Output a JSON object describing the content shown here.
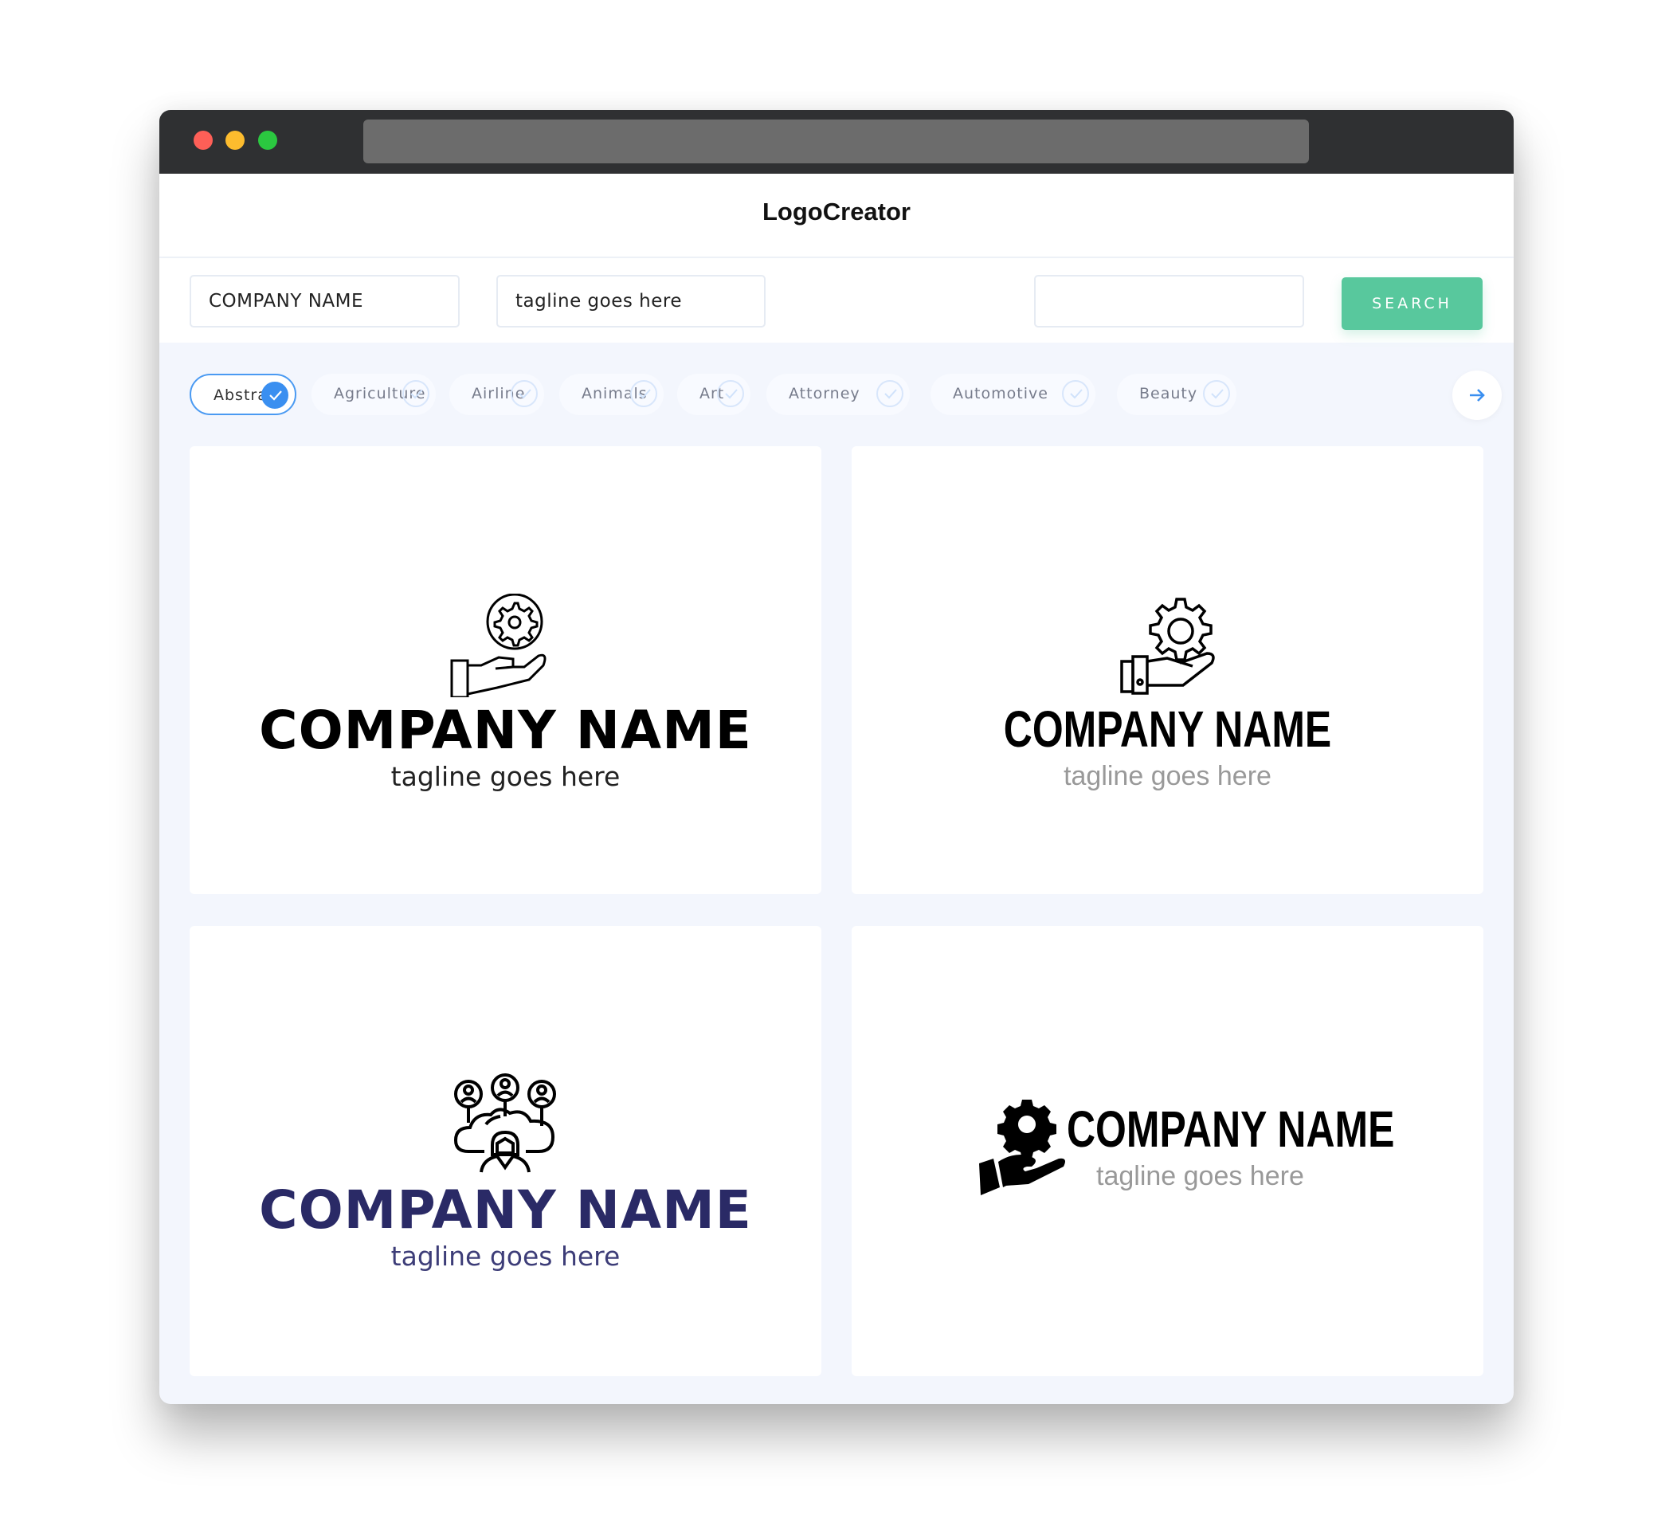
{
  "browser": {
    "traffic_lights": [
      "close",
      "minimize",
      "maximize"
    ],
    "url": ""
  },
  "header": {
    "title": "LogoCreator"
  },
  "search": {
    "company_value": "COMPANY NAME",
    "tagline_value": "tagline goes here",
    "keyword_value": "",
    "button_label": "SEARCH",
    "button_color": "#58c89d"
  },
  "categories": {
    "items": [
      {
        "label": "Abstract",
        "selected": true
      },
      {
        "label": "Agriculture",
        "selected": false
      },
      {
        "label": "Airline",
        "selected": false
      },
      {
        "label": "Animals",
        "selected": false
      },
      {
        "label": "Art",
        "selected": false
      },
      {
        "label": "Attorney",
        "selected": false
      },
      {
        "label": "Automotive",
        "selected": false
      },
      {
        "label": "Beauty",
        "selected": false
      }
    ],
    "next_icon": "arrow-right-icon",
    "accent_color": "#3a8ff0"
  },
  "logos": [
    {
      "company": "COMPANY NAME",
      "tagline": "tagline goes here",
      "icon": "hand-gear-circle-outline-icon",
      "color": "#000000"
    },
    {
      "company": "COMPANY NAME",
      "tagline": "tagline goes here",
      "icon": "hand-gear-outline-icon",
      "color": "#000000"
    },
    {
      "company": "COMPANY NAME",
      "tagline": "tagline goes here",
      "icon": "cloud-network-users-icon",
      "color": "#2a2a66"
    },
    {
      "company": "COMPANY NAME",
      "tagline": "tagline goes here",
      "icon": "hand-gear-solid-icon",
      "color": "#000000"
    }
  ]
}
